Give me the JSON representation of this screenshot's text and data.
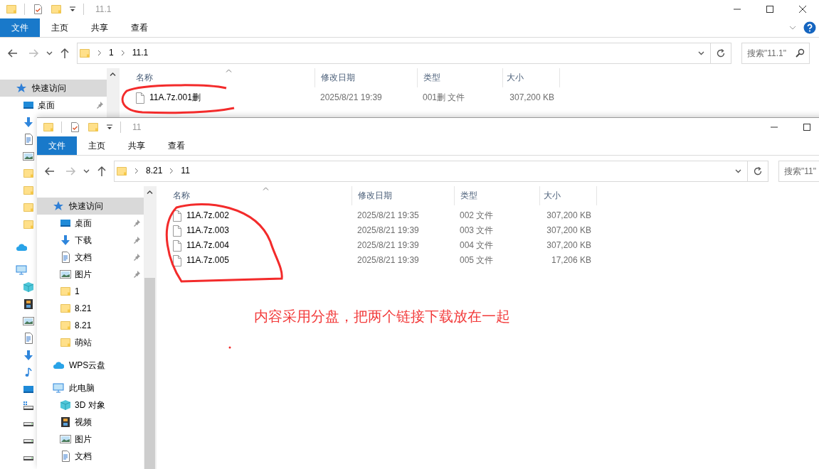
{
  "windows": [
    {
      "title": "11.1",
      "close_button": true,
      "help_button": true,
      "ribbon_tabs": [
        {
          "label": "文件",
          "selected": true
        },
        {
          "label": "主页",
          "selected": false
        },
        {
          "label": "共享",
          "selected": false
        },
        {
          "label": "查看",
          "selected": false
        }
      ],
      "path": [
        "1",
        "11.1"
      ],
      "search": {
        "placeholder": "搜索\"11.1\"",
        "icon": true
      },
      "nav": [
        {
          "kind": "star",
          "label": "快速访问",
          "selected": true,
          "children": [
            {
              "kind": "desktop",
              "label": "桌面",
              "pinned": true,
              "selected": false
            },
            {
              "kind": "download"
            },
            {
              "kind": "document"
            },
            {
              "kind": "picture"
            },
            {
              "kind": "folder"
            },
            {
              "kind": "folder"
            },
            {
              "kind": "folder"
            },
            {
              "kind": "folder"
            }
          ]
        },
        {
          "kind": "cloud"
        },
        {
          "kind": "computer",
          "children": [
            {
              "kind": "cube"
            },
            {
              "kind": "film"
            },
            {
              "kind": "picture"
            },
            {
              "kind": "document"
            },
            {
              "kind": "download"
            },
            {
              "kind": "music"
            },
            {
              "kind": "desktop"
            },
            {
              "kind": "system-drive"
            },
            {
              "kind": "drive"
            },
            {
              "kind": "drive"
            },
            {
              "kind": "drive"
            }
          ]
        }
      ],
      "columns": [
        "名称",
        "修改日期",
        "类型",
        "大小"
      ],
      "rows": [
        {
          "name": "11A.7z.001删",
          "modified": "2025/8/21 19:39",
          "type": "001删 文件",
          "size": "307,200 KB"
        }
      ]
    },
    {
      "title": "11",
      "ribbon_tabs": [
        {
          "label": "文件",
          "selected": true
        },
        {
          "label": "主页",
          "selected": false
        },
        {
          "label": "共享",
          "selected": false
        },
        {
          "label": "查看",
          "selected": false
        }
      ],
      "path": [
        "8.21",
        "11"
      ],
      "search": {
        "placeholder": "搜索\"11\""
      },
      "nav": [
        {
          "kind": "star",
          "label": "快速访问",
          "selected": true,
          "children": [
            {
              "kind": "desktop",
              "label": "桌面",
              "pinned": true,
              "selected": false
            },
            {
              "kind": "download",
              "label": "下载",
              "pinned": true,
              "selected": false
            },
            {
              "kind": "document",
              "label": "文档",
              "pinned": true,
              "selected": false
            },
            {
              "kind": "picture",
              "label": "图片",
              "pinned": true,
              "selected": false
            },
            {
              "kind": "folder",
              "label": "1",
              "selected": false
            },
            {
              "kind": "folder",
              "label": "8.21",
              "selected": false
            },
            {
              "kind": "folder",
              "label": "8.21",
              "selected": false
            },
            {
              "kind": "folder",
              "label": "萌站",
              "selected": false
            }
          ]
        },
        {
          "kind": "cloud",
          "label": "WPS云盘",
          "selected": false
        },
        {
          "kind": "computer",
          "label": "此电脑",
          "selected": false,
          "children": [
            {
              "kind": "cube",
              "label": "3D 对象",
              "selected": false
            },
            {
              "kind": "film",
              "label": "视频",
              "selected": false
            },
            {
              "kind": "picture",
              "label": "图片",
              "selected": false
            },
            {
              "kind": "document",
              "label": "文档",
              "selected": false
            }
          ]
        }
      ],
      "columns": [
        "名称",
        "修改日期",
        "类型",
        "大小"
      ],
      "rows": [
        {
          "name": "11A.7z.002",
          "modified": "2025/8/21 19:35",
          "type": "002 文件",
          "size": "307,200 KB"
        },
        {
          "name": "11A.7z.003",
          "modified": "2025/8/21 19:39",
          "type": "003 文件",
          "size": "307,200 KB"
        },
        {
          "name": "11A.7z.004",
          "modified": "2025/8/21 19:39",
          "type": "004 文件",
          "size": "307,200 KB"
        },
        {
          "name": "11A.7z.005",
          "modified": "2025/8/21 19:39",
          "type": "005 文件",
          "size": "17,206 KB"
        }
      ]
    }
  ],
  "annotation": {
    "note": "内容采用分盘，把两个链接下载放在一起"
  }
}
